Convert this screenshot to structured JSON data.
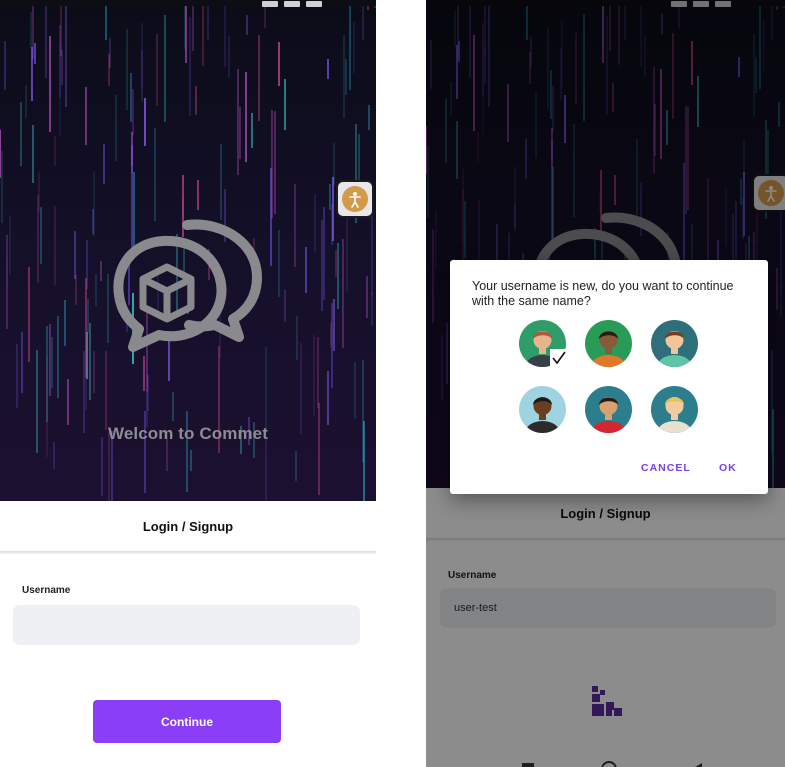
{
  "left_screen": {
    "welcome_text": "Welcom to Commet",
    "tab_title": "Login / Signup",
    "username_label": "Username",
    "username_value": "",
    "continue_label": "Continue"
  },
  "right_screen": {
    "tab_title": "Login / Signup",
    "username_label": "Username",
    "username_value": "user-test",
    "dialog": {
      "message": "Your username is new, do you want to continue with the same name?",
      "avatars": [
        {
          "name": "avatar-1",
          "bg": "#2e9d6a",
          "selected": true
        },
        {
          "name": "avatar-2",
          "bg": "#2a9b57",
          "selected": false
        },
        {
          "name": "avatar-3",
          "bg": "#2f6f7c",
          "selected": false
        },
        {
          "name": "avatar-4",
          "bg": "#9ed3e2",
          "selected": false
        },
        {
          "name": "avatar-5",
          "bg": "#2d7e8d",
          "selected": false
        },
        {
          "name": "avatar-6",
          "bg": "#2d7e8d",
          "selected": false
        }
      ],
      "cancel_label": "CANCEL",
      "ok_label": "OK"
    }
  },
  "colors": {
    "accent": "#8a3ef5",
    "dialog_button": "#7b3fe4",
    "hero_background": "#15102a"
  },
  "icons": [
    "chat-bubbles-cube-logo",
    "accessibility-icon",
    "checkmark-icon",
    "loading-blocks-icon"
  ]
}
